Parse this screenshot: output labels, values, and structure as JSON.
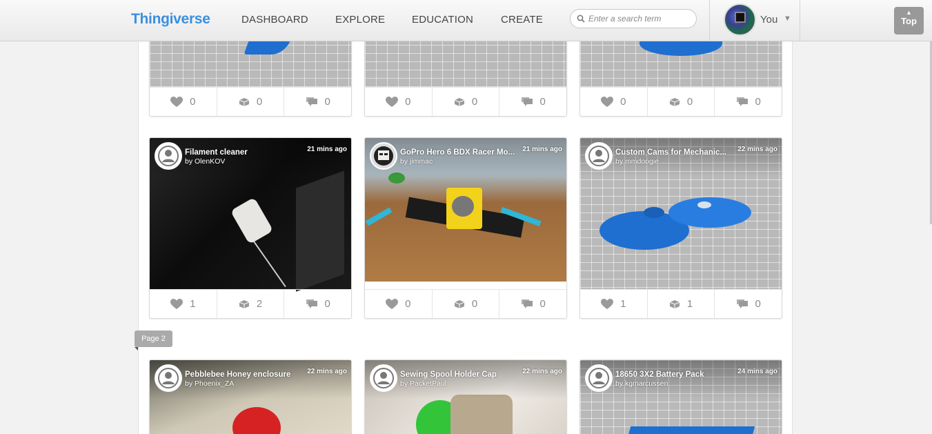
{
  "header": {
    "logo": "Thingiverse",
    "nav": [
      "DASHBOARD",
      "EXPLORE",
      "EDUCATION",
      "CREATE"
    ],
    "search_placeholder": "Enter a search term",
    "user_label": "You",
    "top_button": "Top"
  },
  "page_marker": "Page 2",
  "top_row_stats": [
    {
      "likes": "0",
      "collects": "0",
      "comments": "0"
    },
    {
      "likes": "0",
      "collects": "0",
      "comments": "0"
    },
    {
      "likes": "0",
      "collects": "0",
      "comments": "0"
    }
  ],
  "row2": [
    {
      "title": "Filament cleaner",
      "author": "by OlenKOV",
      "time": "21 mins ago",
      "likes": "1",
      "collects": "2",
      "comments": "0"
    },
    {
      "title": "GoPro Hero 6 BDX Racer Mo...",
      "author": "by jimmac",
      "time": "21 mins ago",
      "likes": "0",
      "collects": "0",
      "comments": "0"
    },
    {
      "title": "Custom Cams for Mechanic...",
      "author": "by mmdoogie",
      "time": "22 mins ago",
      "likes": "1",
      "collects": "1",
      "comments": "0"
    }
  ],
  "row3": [
    {
      "title": "Pebblebee Honey enclosure",
      "author": "by Phoenix_ZA",
      "time": "22 mins ago"
    },
    {
      "title": "Sewing Spool Holder Cap",
      "author": "by PacketPaul",
      "time": "22 mins ago"
    },
    {
      "title": "18650 3X2 Battery Pack",
      "author": "by kgmarcussen",
      "time": "24 mins ago"
    }
  ],
  "colors": {
    "brand": "#3b8fe0",
    "stats_text": "#8a8a8a",
    "printed_blue": "#1e6fd0"
  }
}
